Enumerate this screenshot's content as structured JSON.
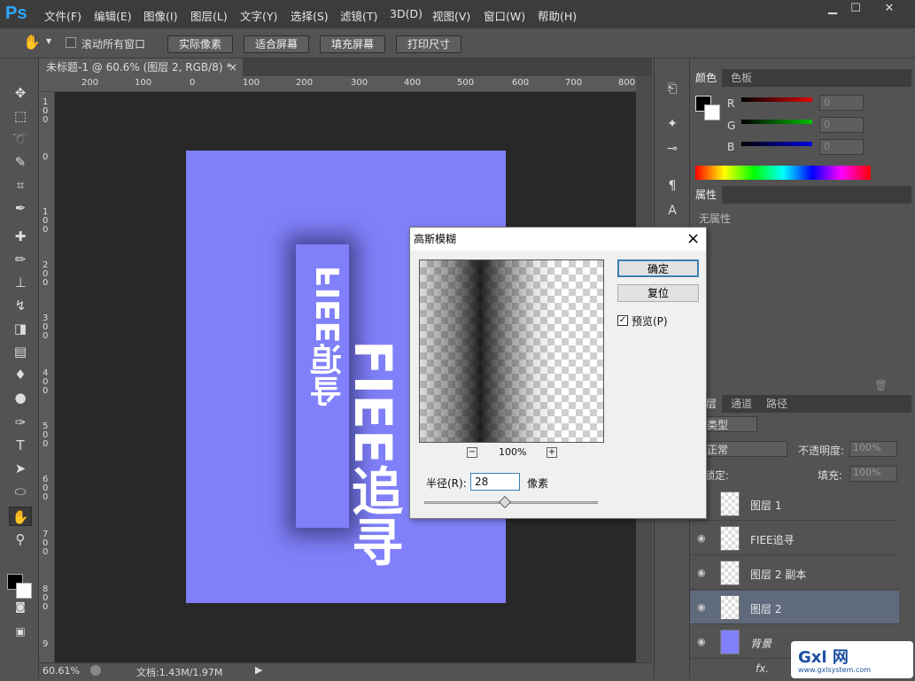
{
  "app": {
    "logo": "Ps",
    "menus": [
      "文件(F)",
      "编辑(E)",
      "图像(I)",
      "图层(L)",
      "文字(Y)",
      "选择(S)",
      "滤镜(T)",
      "3D(D)",
      "视图(V)",
      "窗口(W)",
      "帮助(H)"
    ]
  },
  "options": {
    "scroll_all": "滚动所有窗口",
    "actual_pixels": "实际像素",
    "fit_screen": "适合屏幕",
    "fill_screen": "填充屏幕",
    "print_size": "打印尺寸"
  },
  "document": {
    "tab": "未标题-1 @ 60.6% (图层 2, RGB/8) *",
    "close": "×",
    "zoom": "60.61%",
    "doc_info": "文档:1.43M/1.97M",
    "artwork_text": "FIEE追寻"
  },
  "ruler": {
    "h": [
      "200",
      "100",
      "0",
      "100",
      "200",
      "300",
      "400",
      "500",
      "600",
      "700",
      "800"
    ],
    "v": [
      "1",
      "0",
      "0",
      "1",
      "0",
      "0",
      "2",
      "0",
      "0",
      "3",
      "0",
      "0",
      "4",
      "0",
      "0",
      "5",
      "0",
      "0",
      "6",
      "0",
      "0",
      "7",
      "0",
      "0",
      "8",
      "0",
      "0",
      "9"
    ]
  },
  "color_panel": {
    "tabs": [
      "颜色",
      "色板"
    ],
    "channels": [
      {
        "label": "R",
        "value": "0",
        "color": "#e00000"
      },
      {
        "label": "G",
        "value": "0",
        "color": "#00c000"
      },
      {
        "label": "B",
        "value": "0",
        "color": "#0000e0"
      }
    ]
  },
  "properties": {
    "tab": "属性",
    "empty": "无属性"
  },
  "layers_panel": {
    "tabs": [
      "图层",
      "通道",
      "路径"
    ],
    "filter": "类型",
    "blend": "正常",
    "opacity_label": "不透明度:",
    "opacity": "100%",
    "lock_label": "锁定:",
    "fill_label": "填充:",
    "fill": "100%",
    "fx": "fx.",
    "layers": [
      {
        "name": "图层 1",
        "selected": false
      },
      {
        "name": "FIEE追寻",
        "selected": false
      },
      {
        "name": "图层 2 副本",
        "selected": false
      },
      {
        "name": "图层 2",
        "selected": true
      },
      {
        "name": "背景",
        "selected": false
      }
    ]
  },
  "dialog": {
    "title": "高斯模糊",
    "ok": "确定",
    "reset": "复位",
    "preview_label": "预览(P)",
    "preview_checked": true,
    "zoom": "100%",
    "zoom_out": "−",
    "zoom_in": "+",
    "radius_label": "半径(R):",
    "radius": "28",
    "unit": "像素",
    "close": "×"
  },
  "watermark": {
    "brand": "Gxl 网",
    "url": "www.gxlsystem.com"
  }
}
